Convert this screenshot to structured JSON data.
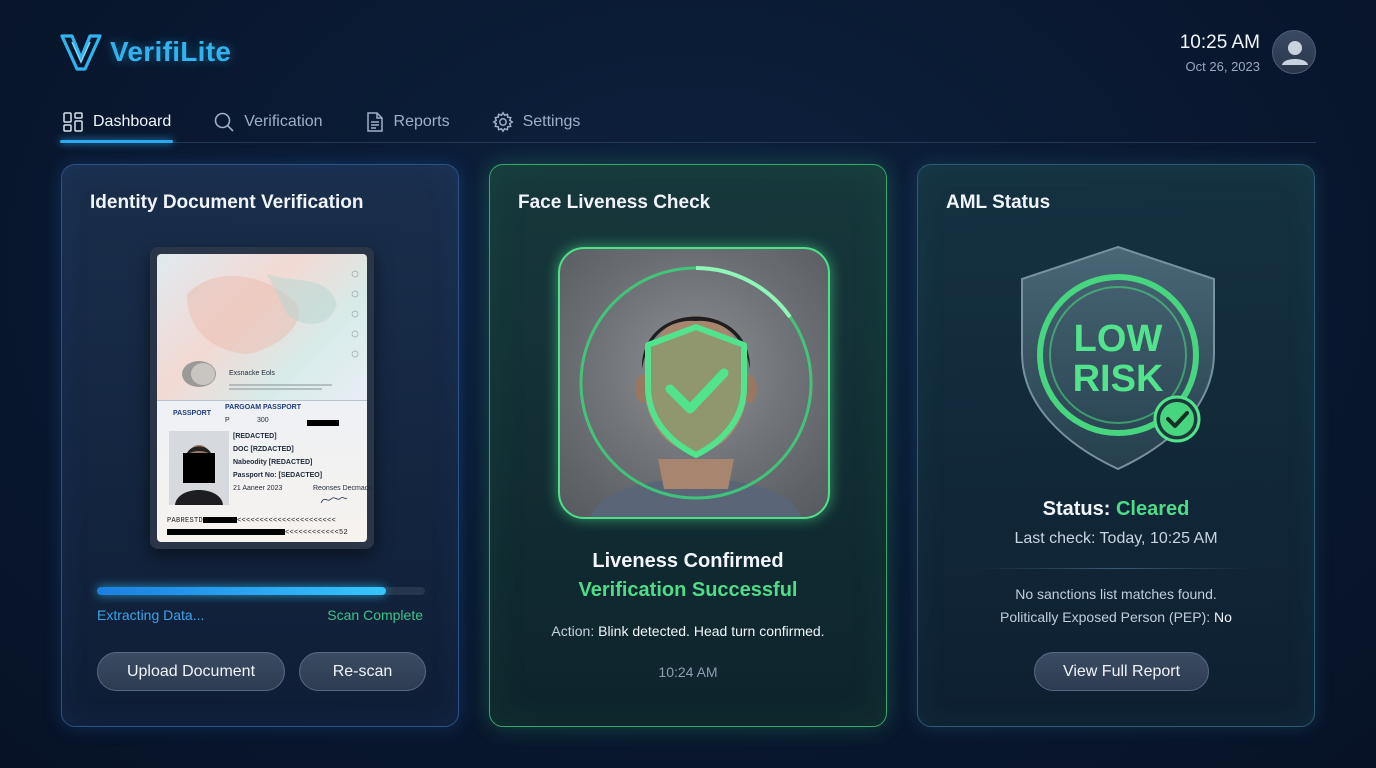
{
  "app": {
    "name": "VerifiLite"
  },
  "header": {
    "time": "10:25 AM",
    "date": "Oct 26, 2023"
  },
  "nav": {
    "tabs": [
      {
        "label": "Dashboard",
        "icon": "grid-icon",
        "active": true
      },
      {
        "label": "Verification",
        "icon": "search-icon",
        "active": false
      },
      {
        "label": "Reports",
        "icon": "document-icon",
        "active": false
      },
      {
        "label": "Settings",
        "icon": "gear-icon",
        "active": false
      }
    ]
  },
  "colors": {
    "accent": "#2ea8ef",
    "success": "#4fdc86",
    "background": "#0a1a33"
  },
  "id_card": {
    "title": "Identity Document Verification",
    "passport": {
      "header_label": "PASSPORT",
      "title": "PARGOAM PASSPORT",
      "type": "P",
      "code": "300",
      "top_line": "Exsnacke Eols",
      "line1": "[REDACTED]",
      "line2": "DOC [RZDACTED]",
      "line3": "Nabeodity [REDACTED]",
      "line4": "Passport No: [SEDACTEO]",
      "issue_date": "21 Aaneer 2023",
      "authority": "Reonses Decmacs",
      "mrz1_prefix": "PABRESTD",
      "mrz1_suffix": "<<<<<<<<<<<<<<<<<<<<<<",
      "mrz2_suffix": "<<<<<<<<<<<<52"
    },
    "progress": 0.88,
    "progress_left": "Extracting Data...",
    "progress_right": "Scan Complete",
    "upload_button": "Upload Document",
    "rescan_button": "Re-scan"
  },
  "face_card": {
    "title": "Face Liveness Check",
    "line1": "Liveness Confirmed",
    "line2": "Verification Successful",
    "action_label": "Action:",
    "action_value": "Blink detected. Head turn confirmed.",
    "time": "10:24 AM"
  },
  "aml_card": {
    "title": "AML Status",
    "badge_line1": "LOW",
    "badge_line2": "RISK",
    "status_label": "Status:",
    "status_value": "Cleared",
    "last_check": "Last check: Today, 10:25 AM",
    "sanctions": "No sanctions list matches found.",
    "pep_label": "Politically Exposed Person (PEP):",
    "pep_value": "No",
    "report_button": "View Full Report"
  }
}
